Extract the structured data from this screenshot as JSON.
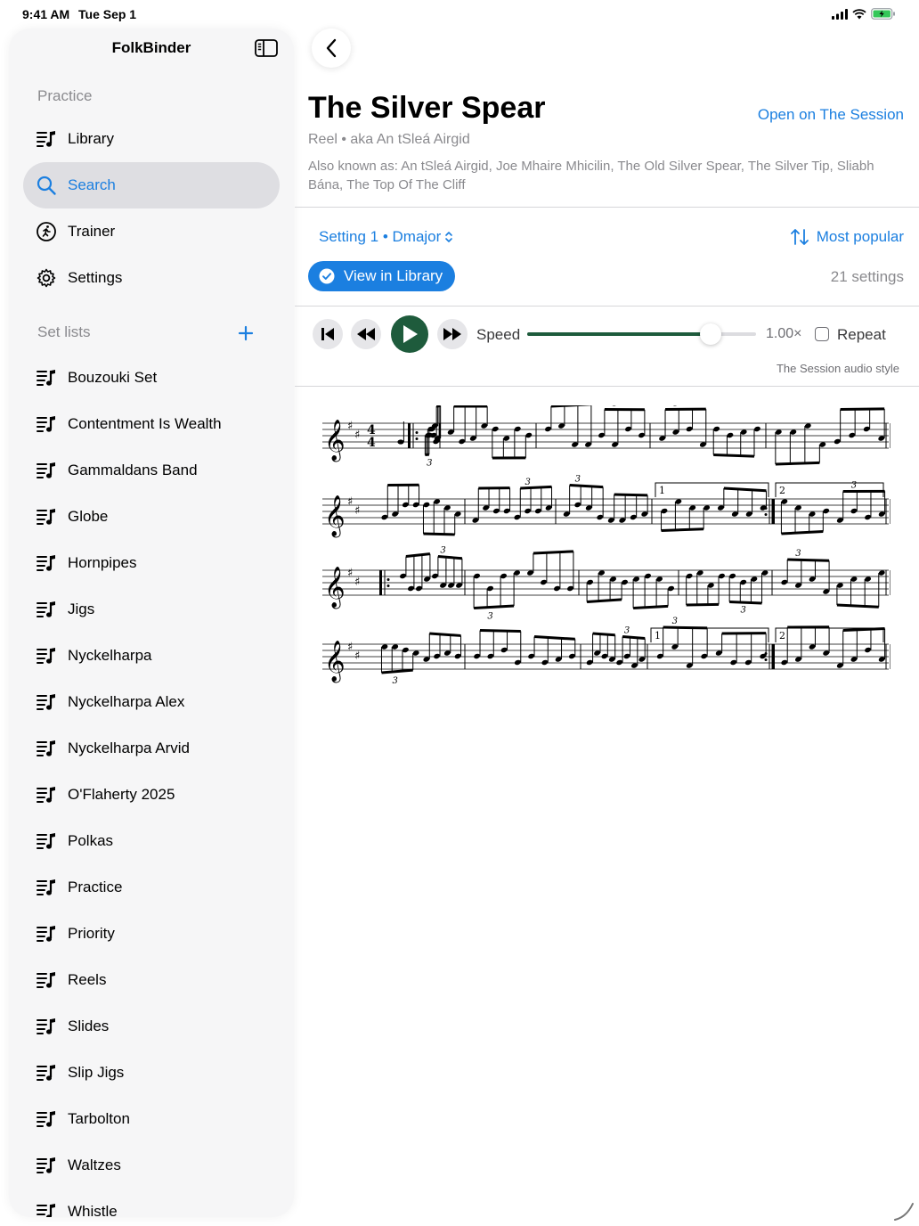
{
  "status": {
    "time": "9:41 AM",
    "date": "Tue Sep 1"
  },
  "sidebar": {
    "title": "FolkBinder",
    "practice_label": "Practice",
    "practice_items": [
      {
        "label": "Library",
        "icon": "list-music-icon"
      },
      {
        "label": "Search",
        "icon": "search-icon",
        "selected": true
      },
      {
        "label": "Trainer",
        "icon": "run-icon"
      },
      {
        "label": "Settings",
        "icon": "gear-icon"
      }
    ],
    "setlists_label": "Set lists",
    "setlists": [
      "Bouzouki Set",
      "Contentment Is Wealth",
      "Gammaldans Band",
      "Globe",
      "Hornpipes",
      "Jigs",
      "Nyckelharpa",
      "Nyckelharpa Alex",
      "Nyckelharpa Arvid",
      "O'Flaherty 2025",
      "Polkas",
      "Practice",
      "Priority",
      "Reels",
      "Slides",
      "Slip Jigs",
      "Tarbolton",
      "Waltzes",
      "Whistle"
    ]
  },
  "tune": {
    "title": "The Silver Spear",
    "open_link": "Open on The Session",
    "subtitle": "Reel • aka An tSleá Airgid",
    "aka": "Also known as: An tSleá Airgid, Joe Mhaire Mhicilin, The Old Silver Spear, The Silver Tip, Sliabh Bána, The Top Of The Cliff",
    "setting": "Setting 1 • Dmajor",
    "sort": "Most popular",
    "view_library": "View in Library",
    "settings_count": "21 settings"
  },
  "player": {
    "speed_label": "Speed",
    "speed_value": "1.00×",
    "speed_fraction": 0.8,
    "repeat_label": "Repeat",
    "repeat_checked": false,
    "audio_style": "The Session audio style"
  },
  "score": {
    "ending_1": "1",
    "ending_2": "2",
    "triplet": "3"
  },
  "colors": {
    "accent": "#1b7fe0",
    "player_green": "#1e5b3c",
    "selected_bg": "#dedee2"
  }
}
